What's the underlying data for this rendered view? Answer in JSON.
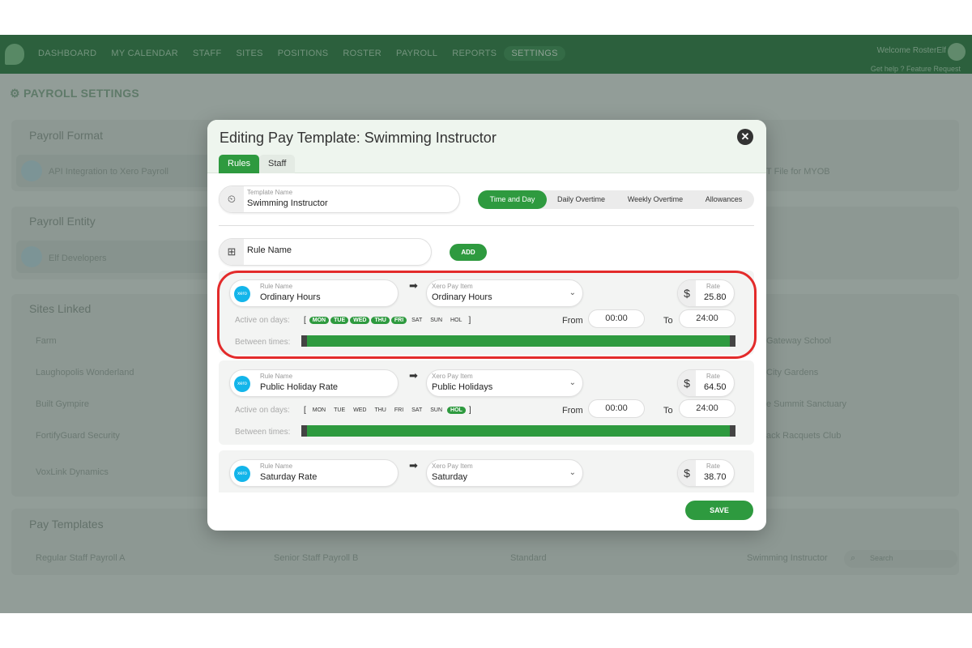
{
  "topbar": {
    "nav": [
      "DASHBOARD",
      "MY CALENDAR",
      "STAFF",
      "SITES",
      "POSITIONS",
      "ROSTER",
      "PAYROLL",
      "REPORTS",
      "SETTINGS"
    ],
    "welcome": "Welcome RosterElf",
    "links": "Get help ?     Feature Request"
  },
  "page": {
    "title": "PAYROLL SETTINGS",
    "payroll_format": {
      "heading": "Payroll Format",
      "left_option": "API Integration to Xero Payroll",
      "right_option": "T File for MYOB"
    },
    "payroll_entity": {
      "heading": "Payroll Entity",
      "option": "Elf Developers"
    },
    "sites_linked": {
      "heading": "Sites Linked",
      "left": [
        "Farm",
        "Laughopolis Wonderland",
        "Built Gympire",
        "FortifyGuard Security",
        "VoxLink Dynamics"
      ],
      "right": [
        "Gateway School",
        "City Gardens",
        "e Summit Sanctuary",
        "ack Racquets Club"
      ]
    },
    "pay_templates": {
      "heading": "Pay Templates",
      "search_placeholder": "Search",
      "items": [
        "Regular Staff Payroll A",
        "Senior Staff Payroll B",
        "Standard",
        "Swimming Instructor"
      ]
    }
  },
  "modal": {
    "title": "Editing Pay Template: Swimming Instructor",
    "tabs": [
      "Rules",
      "Staff"
    ],
    "template_name_label": "Template Name",
    "template_name_value": "Swimming Instructor",
    "segments": [
      "Time and Day",
      "Daily Overtime",
      "Weekly Overtime",
      "Allowances"
    ],
    "rule_name_placeholder": "Rule Name",
    "add_label": "ADD",
    "save_label": "SAVE",
    "labels": {
      "rule_name": "Rule Name",
      "xero_pay_item": "Xero Pay Item",
      "rate": "Rate",
      "active_on_days": "Active on days:",
      "from": "From",
      "to": "To",
      "between_times": "Between times:",
      "xero": "xero"
    },
    "days": [
      "MON",
      "TUE",
      "WED",
      "THU",
      "FRI",
      "SAT",
      "SUN",
      "HOL"
    ],
    "rules": [
      {
        "name": "Ordinary Hours",
        "pay_item": "Ordinary Hours",
        "rate": "25.80",
        "from": "00:00",
        "to": "24:00",
        "active_days": [
          "MON",
          "TUE",
          "WED",
          "THU",
          "FRI"
        ]
      },
      {
        "name": "Public Holiday Rate",
        "pay_item": "Public Holidays",
        "rate": "64.50",
        "from": "00:00",
        "to": "24:00",
        "active_days": [
          "HOL"
        ]
      },
      {
        "name": "Saturday Rate",
        "pay_item": "Saturday",
        "rate": "38.70"
      }
    ]
  },
  "colors": {
    "brand_green": "#2e9a3f",
    "nav_green": "#2f7a45",
    "highlight_red": "#e32b2b",
    "xero_blue": "#13b5ea"
  }
}
